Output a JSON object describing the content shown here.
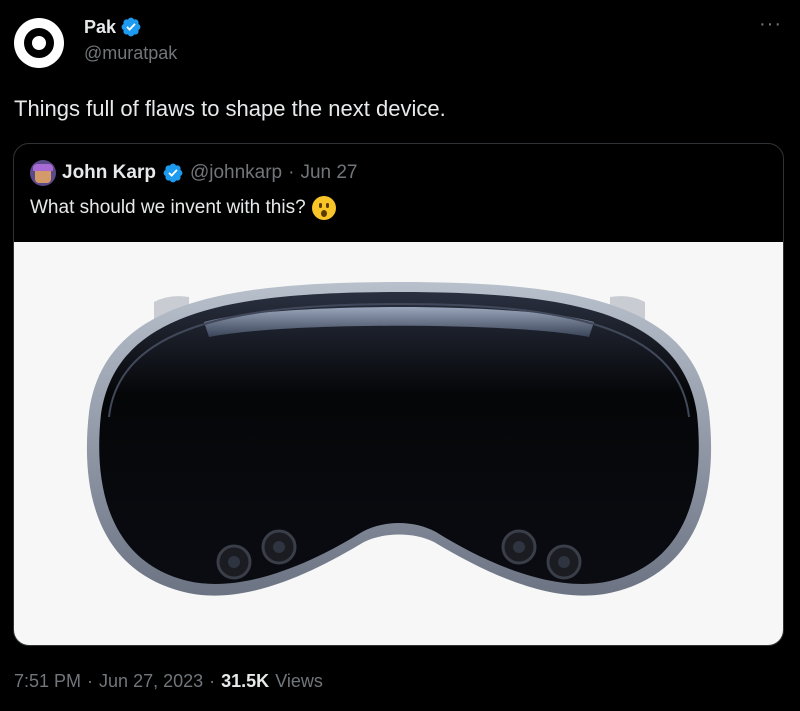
{
  "author": {
    "display_name": "Pak",
    "handle": "@muratpak",
    "verified": true
  },
  "more_label": "···",
  "tweet": {
    "text": "Things full of flaws to shape the next device."
  },
  "quoted": {
    "display_name": "John Karp",
    "handle": "@johnkarp",
    "separator": "·",
    "date": "Jun 27",
    "text": "What should we invent with this?",
    "emoji": "hushed-face-emoji",
    "media": "vision-pro-headset-image"
  },
  "footer": {
    "time": "7:51 PM",
    "sep1": "·",
    "date": "Jun 27, 2023",
    "sep2": "·",
    "views_count": "31.5K",
    "views_label": "Views"
  },
  "colors": {
    "background": "#000000",
    "text": "#e7e9ea",
    "secondary_text": "#71767b",
    "verified_blue": "#1d9bf0",
    "border": "#2f3336"
  }
}
